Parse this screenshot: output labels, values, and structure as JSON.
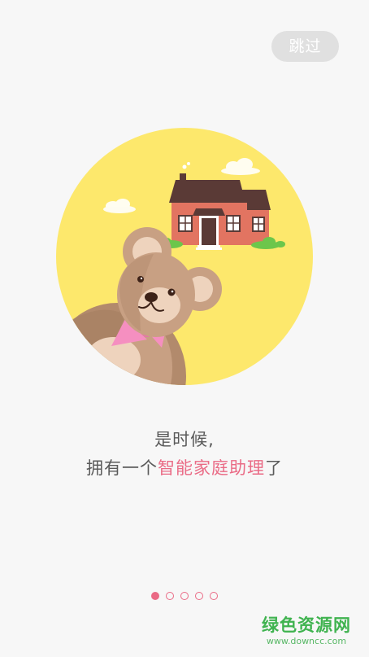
{
  "skip_button": {
    "label": "跳过"
  },
  "caption": {
    "line1": "是时候,",
    "line2_prefix": "拥有一个",
    "line2_highlight": "智能家庭助理",
    "line2_suffix": "了"
  },
  "pager": {
    "total": 5,
    "active_index": 0
  },
  "watermark": {
    "title": "绿色资源网",
    "url": "www.downcc.com"
  },
  "colors": {
    "accent": "#ea6a85",
    "circle": "#fde86c",
    "skip_bg": "#e0e0e0",
    "watermark": "#3fb34f"
  }
}
